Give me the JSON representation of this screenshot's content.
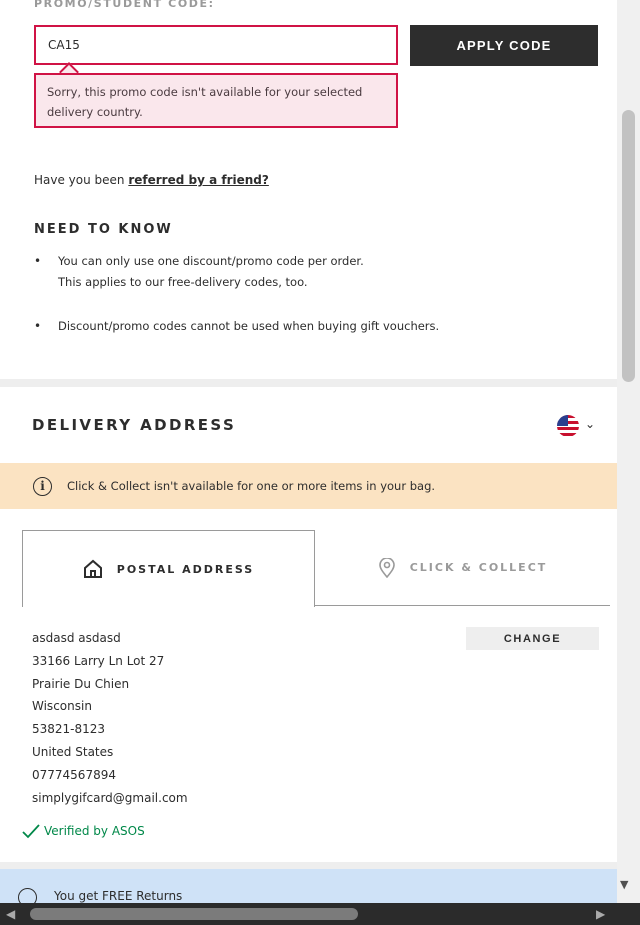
{
  "promo": {
    "label": "PROMO/STUDENT CODE:",
    "input_value": "CA15",
    "apply_label": "APPLY CODE",
    "error": "Sorry, this promo code isn't available for your selected delivery country.",
    "referred_prefix": "Have you been ",
    "referred_link": "referred by a friend?"
  },
  "need_to_know": {
    "heading": "NEED TO KNOW",
    "items": [
      {
        "line1": "You can only use one discount/promo code per order.",
        "line2": "This applies to our free-delivery codes, too."
      },
      {
        "line1": "Discount/promo codes cannot be used when buying gift vouchers.",
        "line2": ""
      }
    ]
  },
  "delivery": {
    "title": "DELIVERY ADDRESS",
    "country_icon": "us-flag-icon",
    "info_banner": "Click & Collect isn't available for one or more items in your bag.",
    "tabs": {
      "postal": "POSTAL ADDRESS",
      "collect": "CLICK & COLLECT"
    },
    "address_lines": [
      "asdasd asdasd",
      "33166 Larry Ln Lot 27",
      "Prairie Du Chien",
      "Wisconsin",
      "53821-8123",
      "United States",
      "07774567894",
      "simplygifcard@gmail.com"
    ],
    "change_label": "CHANGE",
    "verified_label": "Verified by ASOS"
  },
  "returns": {
    "text": "You get FREE Returns"
  },
  "colors": {
    "error_border": "#d01345",
    "error_bg": "#fae7ec",
    "info_bg": "#fbe3c2",
    "verified": "#018849",
    "button_dark": "#2d2d2d"
  }
}
